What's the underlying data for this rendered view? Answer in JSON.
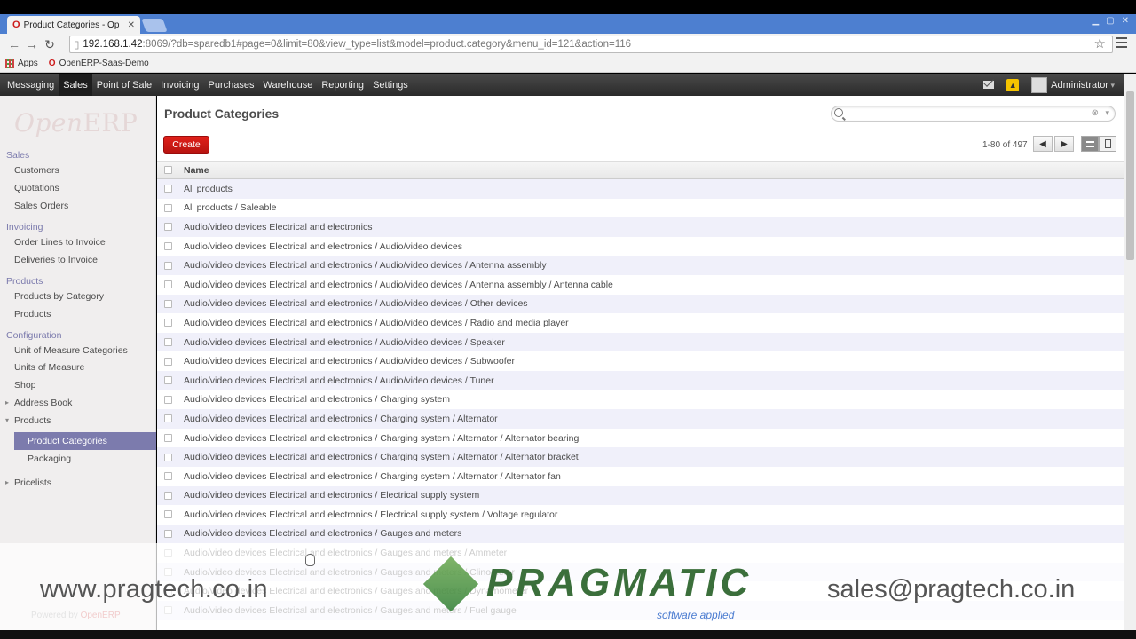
{
  "browser": {
    "tab_title": "Product Categories - Op",
    "url_host": "192.168.1.42",
    "url_rest": ":8069/?db=sparedb1#page=0&limit=80&view_type=list&model=product.category&menu_id=121&action=116",
    "bookmarks": [
      {
        "label": "Apps"
      },
      {
        "label": "OpenERP-Saas-Demo"
      }
    ]
  },
  "appbar": {
    "menus": [
      "Messaging",
      "Sales",
      "Point of Sale",
      "Invoicing",
      "Purchases",
      "Warehouse",
      "Reporting",
      "Settings"
    ],
    "active_menu": "Sales",
    "user": "Administrator"
  },
  "sidebar": {
    "logo": "OpenERP",
    "sections": [
      {
        "title": "Sales",
        "items": [
          "Customers",
          "Quotations",
          "Sales Orders"
        ]
      },
      {
        "title": "Invoicing",
        "items": [
          "Order Lines to Invoice",
          "Deliveries to Invoice"
        ]
      },
      {
        "title": "Products",
        "items": [
          "Products by Category",
          "Products"
        ]
      },
      {
        "title": "Configuration",
        "items": [
          "Unit of Measure Categories",
          "Units of Measure",
          "Shop",
          "Address Book",
          "Products"
        ]
      }
    ],
    "sub_items": [
      "Product Categories",
      "Packaging"
    ],
    "extra_item": "Pricelists",
    "powered_by": "Powered by",
    "powered_brand": "OpenERP"
  },
  "main": {
    "title": "Product Categories",
    "create_label": "Create",
    "search_placeholder": "",
    "pager_text": "1-80 of 497",
    "column_name": "Name",
    "rows": [
      "All products",
      "All products / Saleable",
      "Audio/video devices Electrical and electronics",
      "Audio/video devices Electrical and electronics / Audio/video devices",
      "Audio/video devices Electrical and electronics / Audio/video devices / Antenna assembly",
      "Audio/video devices Electrical and electronics / Audio/video devices / Antenna assembly / Antenna cable",
      "Audio/video devices Electrical and electronics / Audio/video devices / Other devices",
      "Audio/video devices Electrical and electronics / Audio/video devices / Radio and media player",
      "Audio/video devices Electrical and electronics / Audio/video devices / Speaker",
      "Audio/video devices Electrical and electronics / Audio/video devices / Subwoofer",
      "Audio/video devices Electrical and electronics / Audio/video devices / Tuner",
      "Audio/video devices Electrical and electronics / Charging system",
      "Audio/video devices Electrical and electronics / Charging system / Alternator",
      "Audio/video devices Electrical and electronics / Charging system / Alternator / Alternator bearing",
      "Audio/video devices Electrical and electronics / Charging system / Alternator / Alternator bracket",
      "Audio/video devices Electrical and electronics / Charging system / Alternator / Alternator fan",
      "Audio/video devices Electrical and electronics / Electrical supply system",
      "Audio/video devices Electrical and electronics / Electrical supply system / Voltage regulator",
      "Audio/video devices Electrical and electronics / Gauges and meters",
      "Audio/video devices Electrical and electronics / Gauges and meters / Ammeter",
      "Audio/video devices Electrical and electronics / Gauges and meters / Clinometer",
      "Audio/video devices Electrical and electronics / Gauges and meters / Dynamometer",
      "Audio/video devices Electrical and electronics / Gauges and meters / Fuel gauge"
    ]
  },
  "watermark": {
    "website": "www.pragtech.co.in",
    "email": "sales@pragtech.co.in",
    "brand": "PRAGMATIC",
    "tagline": "software applied"
  },
  "colors": {
    "accent": "#7c7bad",
    "create_button": "#d11a14",
    "tabstrip": "#4d7fd0"
  }
}
